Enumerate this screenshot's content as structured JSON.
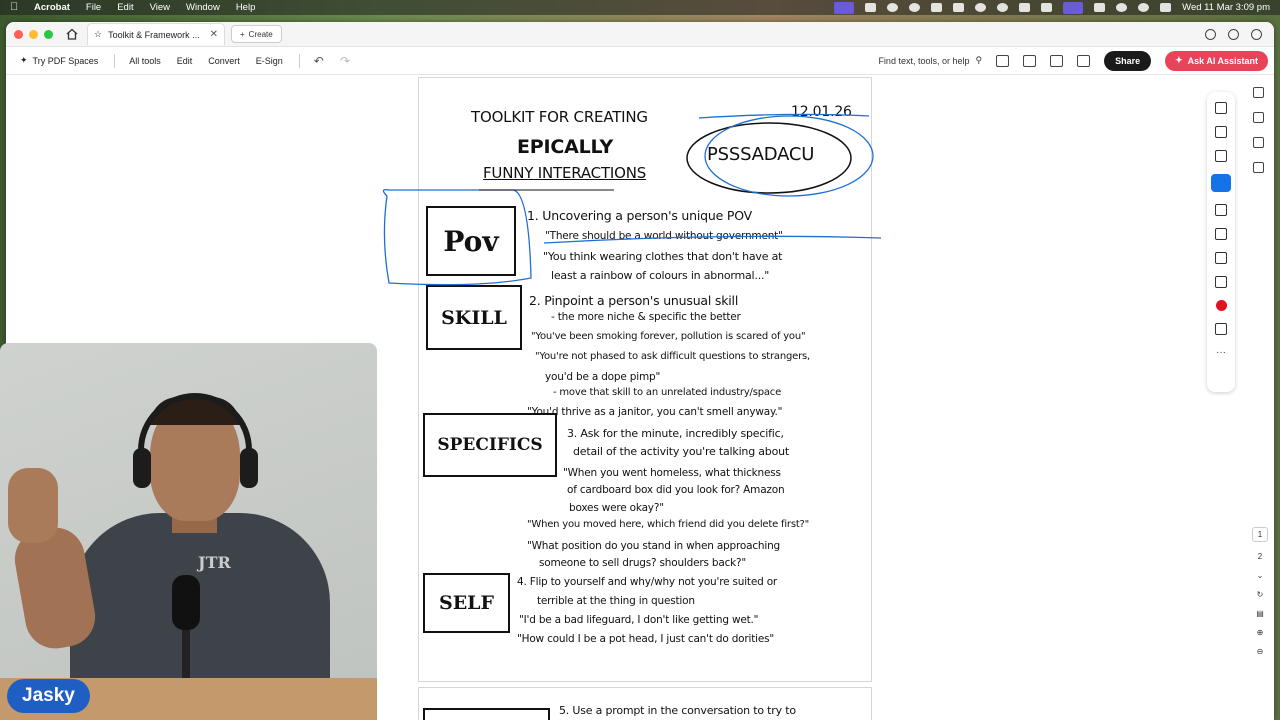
{
  "menubar": {
    "app": "Acrobat",
    "menus": [
      "File",
      "Edit",
      "View",
      "Window",
      "Help"
    ],
    "clock": "Wed 11 Mar  3:09 pm"
  },
  "tabs": {
    "doc_tab": "Toolkit & Framework ...",
    "create": "Create"
  },
  "toolbar": {
    "try_pdf_spaces": "Try PDF Spaces",
    "all_tools": "All tools",
    "edit": "Edit",
    "convert": "Convert",
    "esign": "E-Sign",
    "find": "Find text, tools, or help",
    "share": "Share",
    "ai_assistant": "Ask AI Assistant"
  },
  "document": {
    "title_line1": "TOOLKIT FOR CREATING",
    "title_line2": "EPICALLY",
    "title_line3": "FUNNY INTERACTIONS",
    "date": "12.01.26",
    "acronym": "PSSSADACU",
    "box_pov": "Pov",
    "box_skill": "SKILL",
    "box_specifics": "SPECIFICS",
    "box_self": "SELF",
    "s1_heading": "1. Uncovering a person's unique POV",
    "s1_q1": "\"There should be a world without government\"",
    "s1_q2a": "\"You think wearing clothes that don't have at",
    "s1_q2b": "least a rainbow of colours in abnormal...\"",
    "s2_heading": "2. Pinpoint a person's unusual skill",
    "s2_sub": "- the more niche & specific the better",
    "s2_q1": "\"You've been smoking forever, pollution is scared of you\"",
    "s2_q2a": "\"You're not phased to ask difficult questions to strangers,",
    "s2_q2b": "you'd be a dope pimp\"",
    "s2_note": "- move that skill to an unrelated industry/space",
    "s2_q3": "\"You'd thrive as a janitor, you can't smell anyway.\"",
    "s3_heading_a": "3. Ask for the minute, incredibly specific,",
    "s3_heading_b": "detail of the activity you're talking about",
    "s3_q1a": "\"When you went homeless, what thickness",
    "s3_q1b": "of cardboard box did you look for? Amazon",
    "s3_q1c": "boxes were okay?\"",
    "s3_q2": "\"When you moved here, which friend did you delete first?\"",
    "s3_q3a": "\"What position do you stand in when approaching",
    "s3_q3b": "someone to sell drugs? shoulders back?\"",
    "s4_heading_a": "4. Flip to yourself and why/why not you're suited or",
    "s4_heading_b": "terrible at the thing in question",
    "s4_q1": "\"I'd be a bad lifeguard, I don't like getting wet.\"",
    "s4_q2": "\"How could I be a pot head, I just can't do dorities\"",
    "s5_heading": "5. Use a prompt in the conversation to try to"
  },
  "page_nav": {
    "current": "1",
    "next": "2"
  },
  "overlay": {
    "name": "Jasky",
    "shirt_text": "JTR"
  },
  "colors": {
    "ink": "#111111",
    "annotation_blue": "#1f6fd1",
    "share_bg": "#1a1a1a",
    "ai_bg": "#e9435a",
    "name_badge": "#1f5fc4"
  }
}
